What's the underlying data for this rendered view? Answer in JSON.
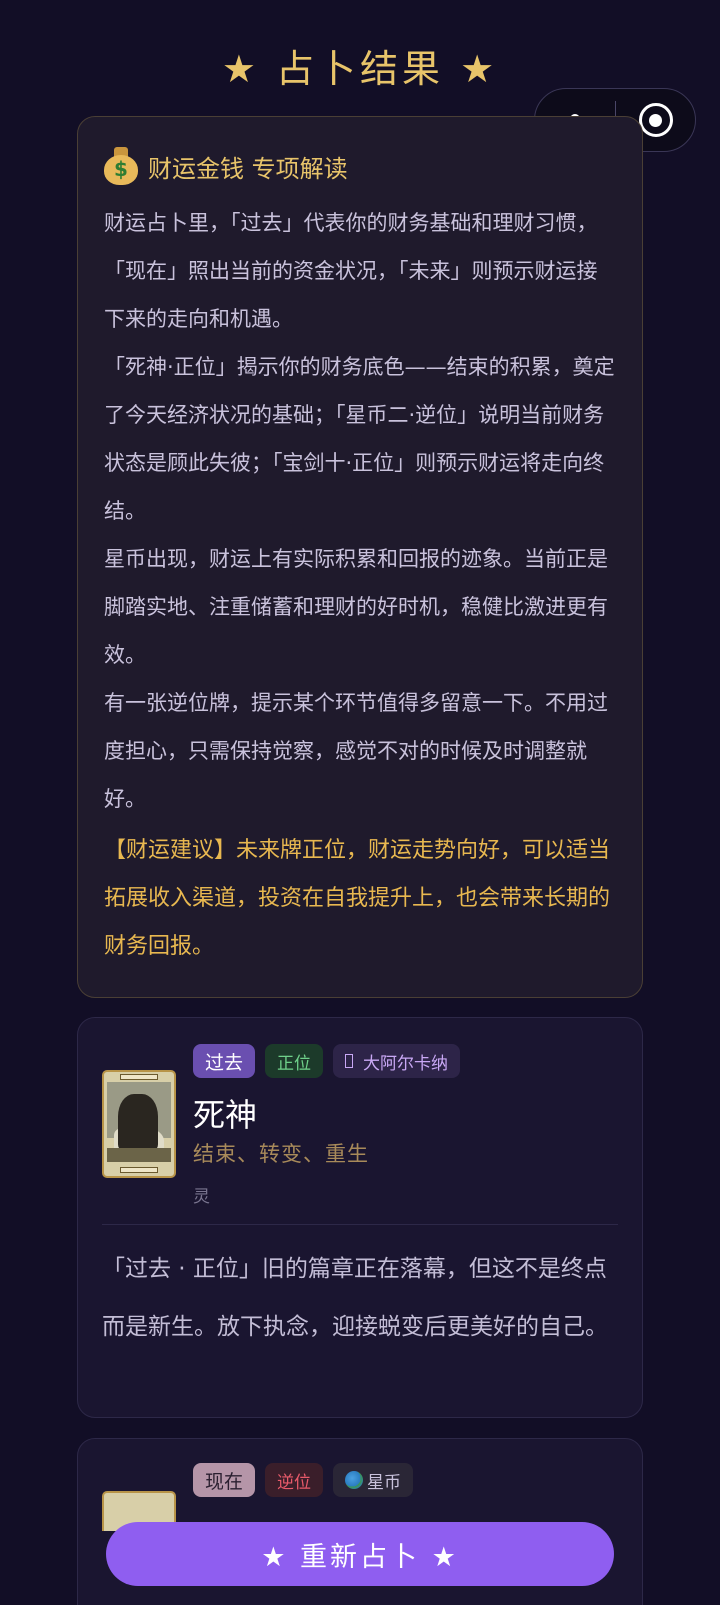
{
  "header": {
    "title": "★ 占卜结果 ★"
  },
  "money_reading": {
    "title": "财运金钱 专项解读",
    "paragraphs": [
      "财运占卜里，「过去」代表你的财务基础和理财习惯，「现在」照出当前的资金状况，「未来」则预示财运接下来的走向和机遇。",
      "「死神·正位」揭示你的财务底色——结束的积累，奠定了今天经济状况的基础；「星币二·逆位」说明当前财务状态是顾此失彼；「宝剑十·正位」则预示财运将走向终结。",
      "星币出现，财运上有实际积累和回报的迹象。当前正是脚踏实地、注重储蓄和理财的好时机，稳健比激进更有效。",
      "有一张逆位牌，提示某个环节值得多留意一下。不用过度担心，只需保持觉察，感觉不对的时候及时调整就好。"
    ],
    "advice": "【财运建议】未来牌正位，财运走势向好，可以适当拓展收入渠道，投资在自我提升上，也会带来长期的财务回报。"
  },
  "cards": [
    {
      "time": "过去",
      "orientation": "正位",
      "arcana": "大阿尔卡纳",
      "name": "死神",
      "keywords": "结束、转变、重生",
      "element": "灵",
      "meaning": "「过去 · 正位」旧的篇章正在落幕，但这不是终点而是新生。放下执念，迎接蜕变后更美好的自己。"
    },
    {
      "time": "现在",
      "orientation": "逆位",
      "suit": "星币"
    }
  ],
  "footer": {
    "retry_label": "★  重新占卜  ★"
  }
}
